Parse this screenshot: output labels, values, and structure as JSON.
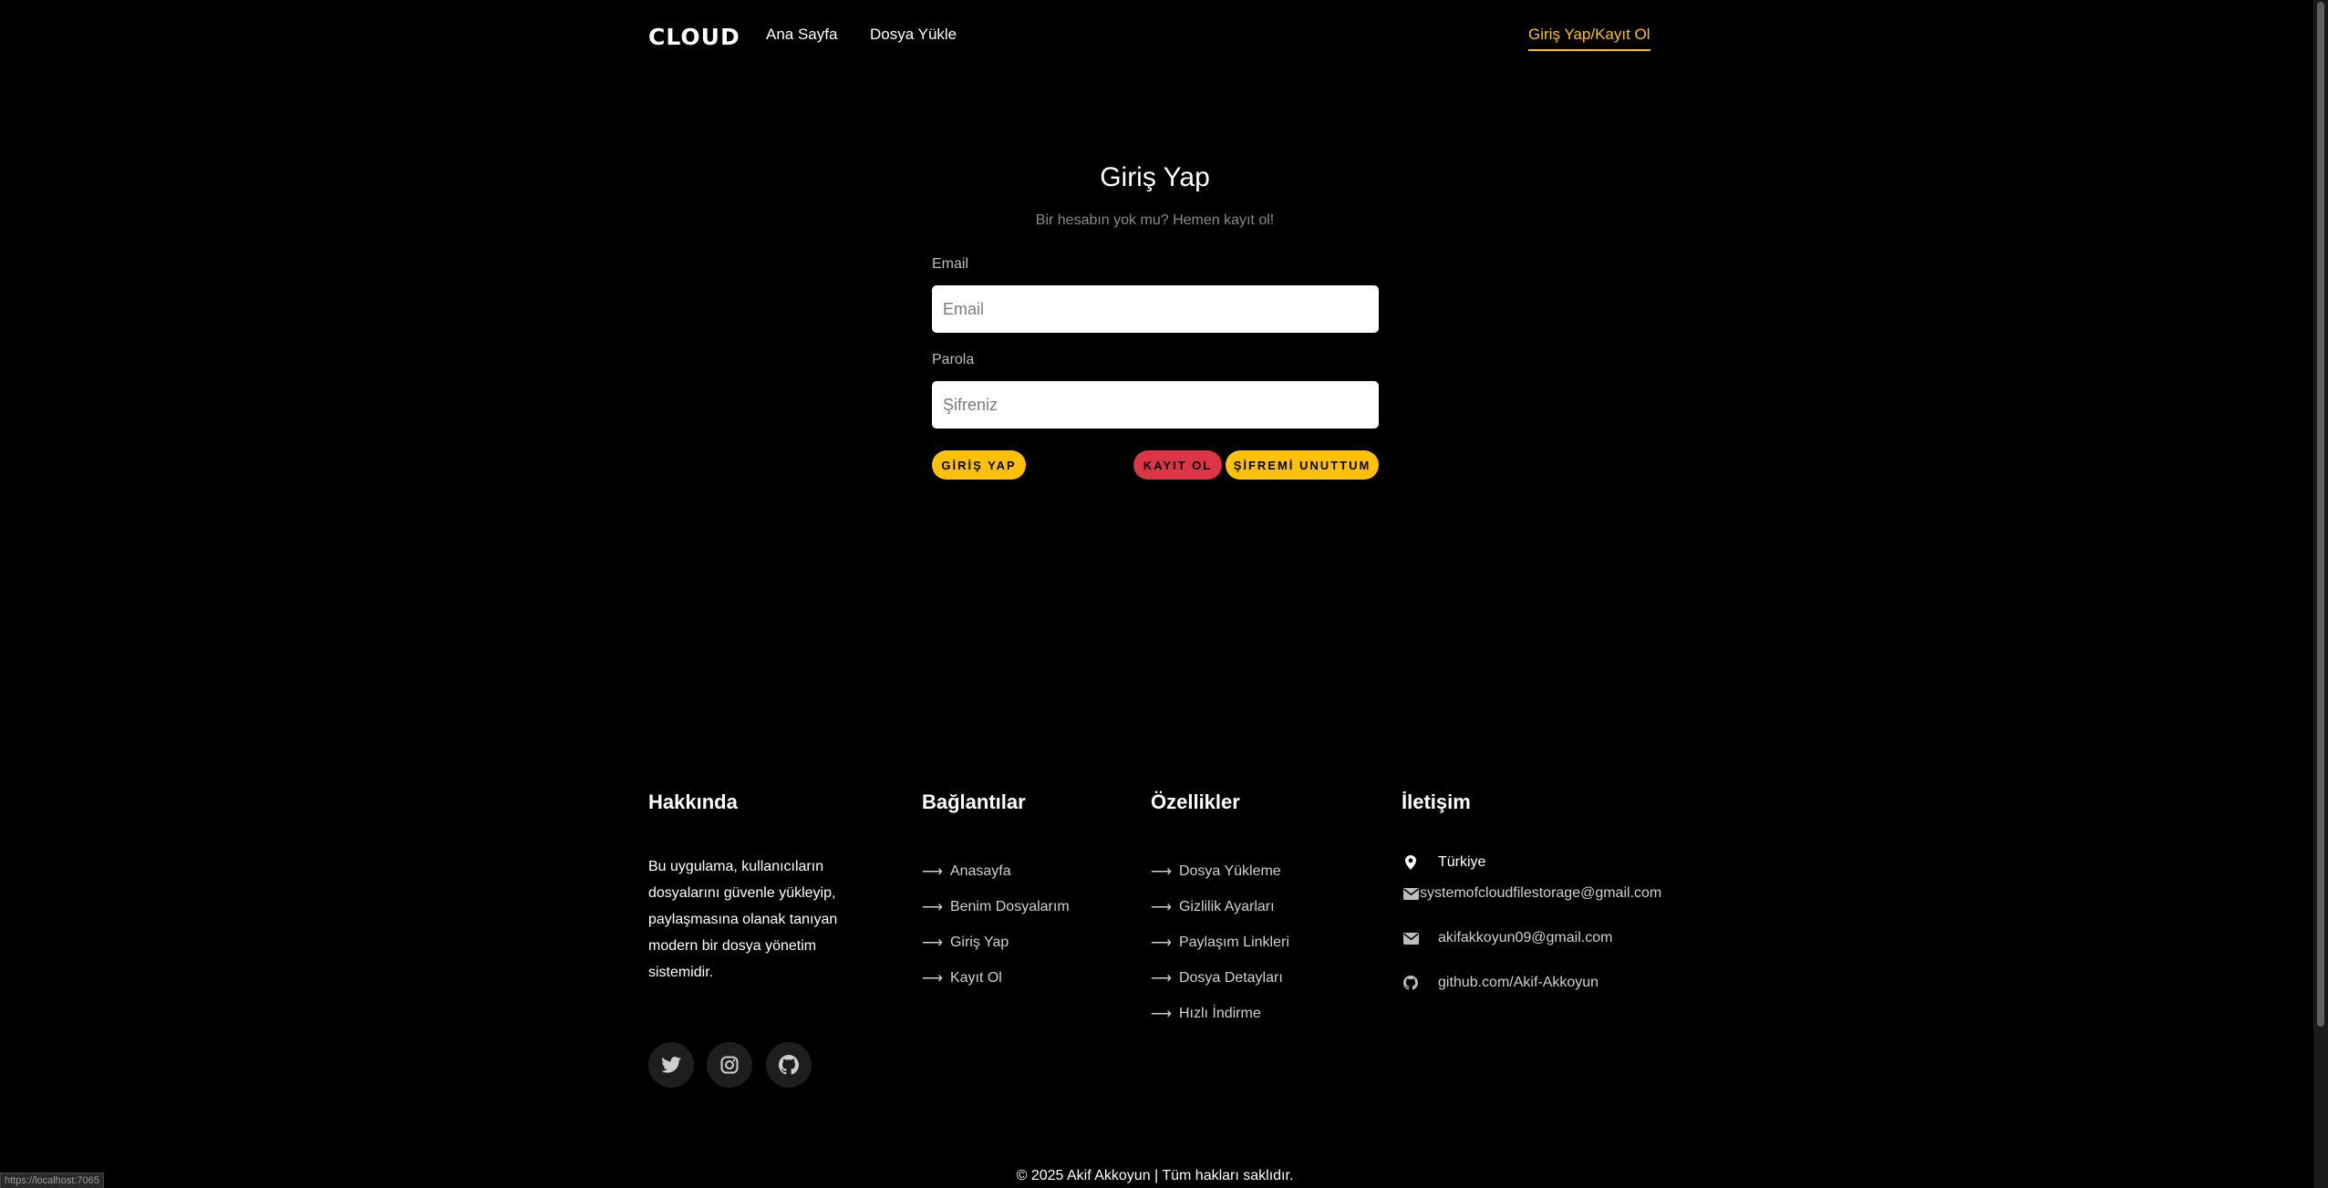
{
  "nav": {
    "brand": "CLOUD",
    "home": "Ana Sayfa",
    "upload": "Dosya Yükle",
    "login_register": "Giriş Yap/Kayıt Ol"
  },
  "login": {
    "title": "Giriş Yap",
    "subtitle": "Bir hesabın yok mu? Hemen kayıt ol!",
    "email_label": "Email",
    "email_placeholder": "Email",
    "email_value": "",
    "password_label": "Parola",
    "password_placeholder": "Şifreniz",
    "password_value": "",
    "login_button": "GİRİŞ YAP",
    "register_button": "KAYIT OL",
    "forgot_button": "ŞİFREMİ UNUTTUM"
  },
  "footer": {
    "about": {
      "heading": "Hakkında",
      "text": "Bu uygulama, kullanıcıların dosyalarını güvenle yükleyip, paylaşmasına olanak tanıyan modern bir dosya yönetim sistemidir."
    },
    "links": {
      "heading": "Bağlantılar",
      "items": [
        "Anasayfa",
        "Benim Dosyalarım",
        "Giriş Yap",
        "Kayıt Ol"
      ]
    },
    "features": {
      "heading": "Özellikler",
      "items": [
        "Dosya Yükleme",
        "Gizlilik Ayarları",
        "Paylaşım Linkleri",
        "Dosya Detayları",
        "Hızlı İndirme"
      ]
    },
    "contact": {
      "heading": "İletişim",
      "location": "Türkiye",
      "email1": "systemofcloudfilestorage@gmail.com",
      "email2": "akifakkoyun09@gmail.com",
      "github": "github.com/Akif-Akkoyun"
    },
    "social_icons": [
      "twitter-icon",
      "instagram-icon",
      "github-icon"
    ],
    "copyright": "© 2025 Akif Akkoyun | Tüm hakları saklıdır."
  },
  "status_bar": {
    "url": "https://localhost:7065"
  },
  "colors": {
    "background": "#000000",
    "accent": "#ffc107",
    "danger": "#dc3545",
    "muted": "#8a8a8a",
    "social_bg": "#1e1e1e"
  }
}
